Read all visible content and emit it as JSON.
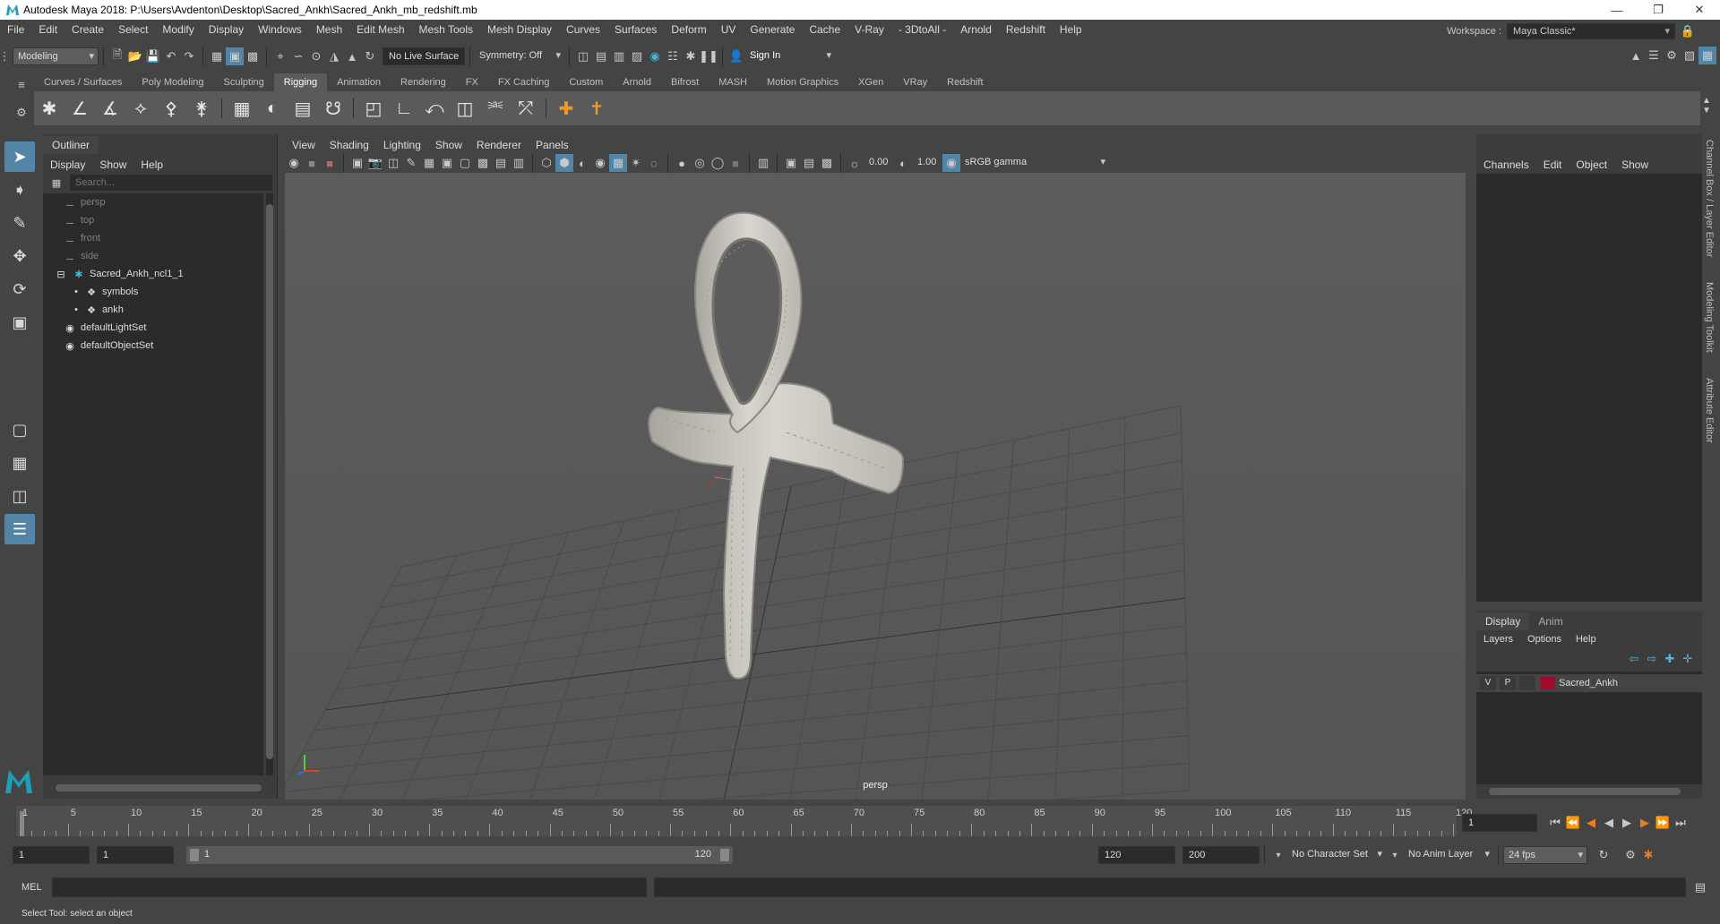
{
  "titlebar": {
    "title": "Autodesk Maya 2018: P:\\Users\\Avdenton\\Desktop\\Sacred_Ankh\\Sacred_Ankh_mb_redshift.mb",
    "minimize": "—",
    "maximize": "❐",
    "close": "✕"
  },
  "menubar": {
    "items": [
      "File",
      "Edit",
      "Create",
      "Select",
      "Modify",
      "Display",
      "Windows",
      "Mesh",
      "Edit Mesh",
      "Mesh Tools",
      "Mesh Display",
      "Curves",
      "Surfaces",
      "Deform",
      "UV",
      "Generate",
      "Cache",
      "V-Ray",
      "- 3DtoAll -",
      "Arnold",
      "Redshift",
      "Help"
    ],
    "workspace_label": "Workspace :",
    "workspace_value": "Maya Classic*"
  },
  "statusline": {
    "mode": "Modeling",
    "live_surface": "No Live Surface",
    "symmetry": "Symmetry: Off",
    "sign_in": "Sign In"
  },
  "shelf": {
    "tabs": [
      "Curves / Surfaces",
      "Poly Modeling",
      "Sculpting",
      "Rigging",
      "Animation",
      "Rendering",
      "FX",
      "FX Caching",
      "Custom",
      "Arnold",
      "Bifrost",
      "MASH",
      "Motion Graphics",
      "XGen",
      "VRay",
      "Redshift"
    ],
    "active_tab": "Rigging"
  },
  "outliner": {
    "tab_label": "Outliner",
    "menus": [
      "Display",
      "Show",
      "Help"
    ],
    "search_placeholder": "Search...",
    "items": [
      {
        "label": "persp",
        "kind": "camera",
        "dim": true,
        "indent": 1
      },
      {
        "label": "top",
        "kind": "camera",
        "dim": true,
        "indent": 1
      },
      {
        "label": "front",
        "kind": "camera",
        "dim": true,
        "indent": 1
      },
      {
        "label": "side",
        "kind": "camera",
        "dim": true,
        "indent": 1
      },
      {
        "label": "Sacred_Ankh_ncl1_1",
        "kind": "group",
        "dim": false,
        "indent": 0
      },
      {
        "label": "symbols",
        "kind": "mesh",
        "dim": false,
        "indent": 2
      },
      {
        "label": "ankh",
        "kind": "mesh",
        "dim": false,
        "indent": 2
      },
      {
        "label": "defaultLightSet",
        "kind": "set",
        "dim": false,
        "indent": 1
      },
      {
        "label": "defaultObjectSet",
        "kind": "set",
        "dim": false,
        "indent": 1
      }
    ]
  },
  "viewport": {
    "menus": [
      "View",
      "Shading",
      "Lighting",
      "Show",
      "Renderer",
      "Panels"
    ],
    "exposure": "0.00",
    "gamma": "1.00",
    "color_space": "sRGB gamma",
    "camera_label": "persp"
  },
  "channelbox": {
    "menus": [
      "Channels",
      "Edit",
      "Object",
      "Show"
    ],
    "side_tabs": [
      "Channel Box / Layer Editor",
      "Modeling Toolkit",
      "Attribute Editor"
    ]
  },
  "layereditor": {
    "tabs": [
      "Display",
      "Anim"
    ],
    "active_tab": "Display",
    "menus": [
      "Layers",
      "Options",
      "Help"
    ],
    "layer": {
      "v": "V",
      "p": "P",
      "name": "Sacred_Ankh",
      "color": "#a00c2a"
    }
  },
  "timeslider": {
    "ticks": [
      "1",
      "5",
      "10",
      "15",
      "20",
      "25",
      "30",
      "35",
      "40",
      "45",
      "50",
      "55",
      "60",
      "65",
      "70",
      "75",
      "80",
      "85",
      "90",
      "95",
      "100",
      "105",
      "110",
      "115",
      "120"
    ],
    "current_frame": "1"
  },
  "rangebar": {
    "start": "1",
    "anim_start": "1",
    "range_start": "1",
    "range_end": "120",
    "end": "120",
    "anim_end": "200",
    "character_set": "No Character Set",
    "anim_layer": "No Anim Layer",
    "fps": "24 fps"
  },
  "cmdline": {
    "label": "MEL"
  },
  "helpline": {
    "text": "Select Tool: select an object"
  }
}
